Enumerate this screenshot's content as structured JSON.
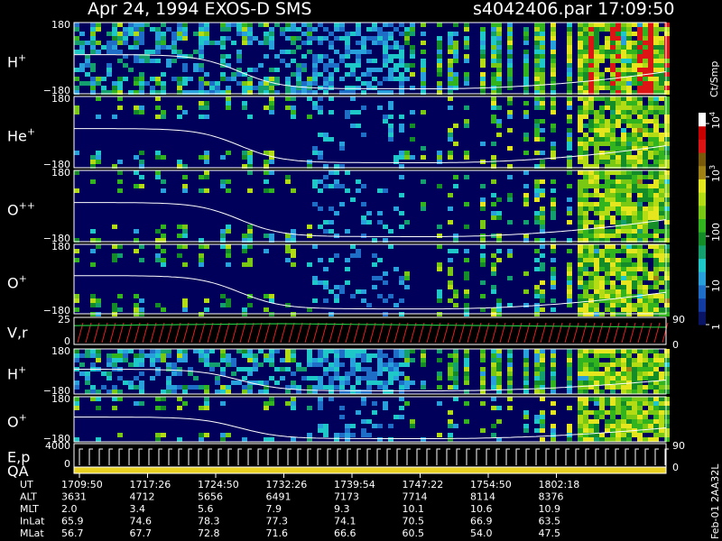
{
  "header": {
    "title": "Apr 24, 1994    EXOS-D SMS",
    "file": "s4042406.par  17:09:50"
  },
  "colorbar": {
    "unit": "Ct/Smp",
    "tick_labels": [
      "1",
      "10",
      "100",
      "10",
      "10"
    ],
    "tick_exponents": [
      "",
      "",
      "",
      "3",
      "4"
    ],
    "colors": [
      "#0a1464",
      "#123ca0",
      "#1e6ec8",
      "#28a0dc",
      "#1ec8c8",
      "#14a06e",
      "#148c28",
      "#32b41e",
      "#78c814",
      "#b4dc14",
      "#e6e61e",
      "#a08214",
      "#785a0a",
      "#dc1414",
      "#c80000",
      "#ffffff"
    ]
  },
  "side_label": "Feb-01 2AA32L",
  "colors": {
    "background": "#00005a",
    "panel_border": "#ffffff",
    "curve": "#ffffff",
    "pitch_red": "#e02020",
    "pitch_green": "#20c040"
  },
  "chart_data": {
    "type": "heatmap",
    "panels": [
      {
        "label": "H",
        "sup": "+",
        "ylim": [
          -180,
          180
        ],
        "ytick_labels": [
          "180",
          "−180"
        ]
      },
      {
        "label": "He",
        "sup": "+",
        "ylim": [
          -180,
          180
        ],
        "ytick_labels": [
          "180",
          "−180"
        ]
      },
      {
        "label": "O",
        "sup": "++",
        "ylim": [
          -180,
          180
        ],
        "ytick_labels": [
          "180",
          "−180"
        ]
      },
      {
        "label": "O",
        "sup": "+",
        "ylim": [
          -180,
          180
        ],
        "ytick_labels": [
          "180",
          "−180"
        ]
      },
      {
        "label": "V,r",
        "sup": "",
        "ylim": [
          0,
          25
        ],
        "ytick_labels": [
          "25",
          "0"
        ],
        "right_tick_labels": [
          "90",
          "0"
        ]
      },
      {
        "label": "H",
        "sup": "+",
        "ylim": [
          -180,
          180
        ],
        "ytick_labels": [
          "180",
          "−180"
        ]
      },
      {
        "label": "O",
        "sup": "+",
        "ylim": [
          -180,
          180
        ],
        "ytick_labels": [
          "180",
          "−180"
        ]
      },
      {
        "label": "E,p",
        "sup": "",
        "ylim": [
          0,
          4000
        ],
        "ytick_labels": [
          "4000",
          "0"
        ],
        "right_tick_labels": [
          "90",
          "0"
        ]
      },
      {
        "label": "QA",
        "sup": "",
        "ylim": [
          0,
          1
        ],
        "ytick_labels": [],
        "right_tick_labels": []
      }
    ],
    "ephemeris": {
      "row_labels": [
        "UT",
        "ALT",
        "MLT",
        "InLat",
        "MLat"
      ],
      "columns": [
        [
          "1709:50",
          "3631",
          "2.0",
          "65.9",
          "56.7"
        ],
        [
          "1717:26",
          "4712",
          "3.4",
          "74.6",
          "67.7"
        ],
        [
          "1724:50",
          "5656",
          "5.6",
          "78.3",
          "72.8"
        ],
        [
          "1732:26",
          "6491",
          "7.9",
          "77.3",
          "71.6"
        ],
        [
          "1739:54",
          "7173",
          "9.3",
          "74.1",
          "66.6"
        ],
        [
          "1747:22",
          "7714",
          "10.1",
          "70.5",
          "60.5"
        ],
        [
          "1754:50",
          "8114",
          "10.6",
          "66.9",
          "54.0"
        ],
        [
          "1802:18",
          "8376",
          "10.9",
          "63.5",
          "47.5"
        ]
      ]
    }
  }
}
